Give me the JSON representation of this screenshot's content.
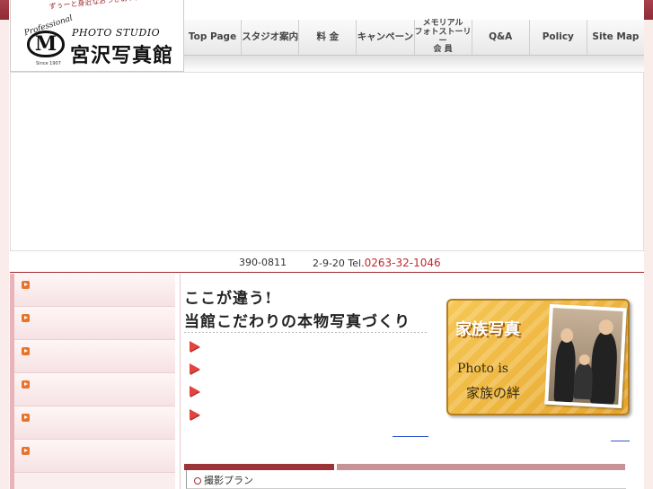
{
  "logo": {
    "tagline": "ずぅーと身近なおつきあい,あなたの街の写真館です",
    "professional": "Professional",
    "mark": "M",
    "since": "Since 1907",
    "studio": "PHOTO STUDIO",
    "name": "宮沢写真館"
  },
  "nav": {
    "items": [
      {
        "label": "Top Page"
      },
      {
        "label": "スタジオ案内"
      },
      {
        "label": "料 金"
      },
      {
        "label": "キャンペーン"
      },
      {
        "label": "メモリアル\nフォトストーリー\n会 員"
      },
      {
        "label": "Q&A"
      },
      {
        "label": "Policy"
      },
      {
        "label": "Site Map"
      }
    ]
  },
  "address": {
    "zip": "390-0811",
    "addr_prefix": "2-9-20 Tel.",
    "tel": "0263-32-1046"
  },
  "main": {
    "heading1": "ここが違う!",
    "heading2": "当館こだわりの本物写真づくり"
  },
  "banner": {
    "title": "家族写真",
    "sub": "Photo is",
    "sub2": "家族の絆"
  },
  "section": {
    "title": "撮影プラン"
  },
  "colors": {
    "brand": "#9c3338",
    "tel": "#c0282e",
    "banner": "#f0b840"
  }
}
